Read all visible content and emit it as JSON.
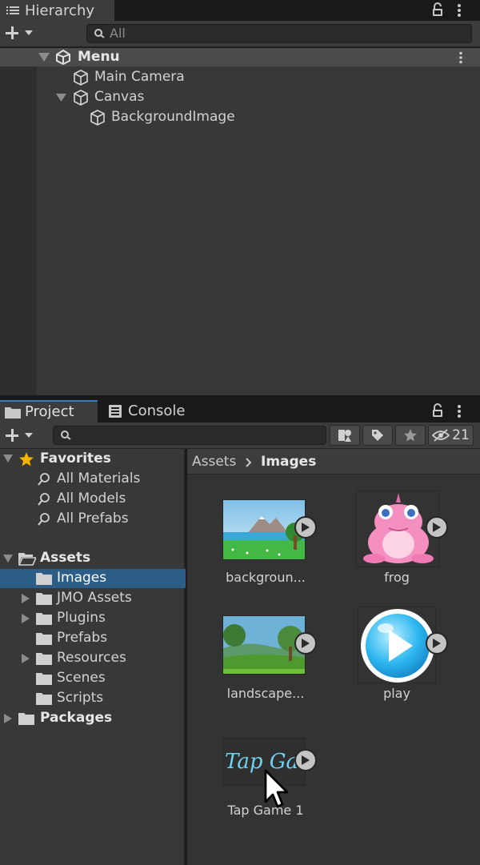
{
  "hierarchy": {
    "tab_label": "Hierarchy",
    "search_placeholder": "All",
    "scene_name": "Menu",
    "items": [
      {
        "label": "Main Camera"
      },
      {
        "label": "Canvas"
      },
      {
        "label": "BackgroundImage"
      }
    ]
  },
  "project": {
    "tabs": [
      {
        "label": "Project"
      },
      {
        "label": "Console"
      }
    ],
    "hidden_count": "21",
    "tree": {
      "favorites_label": "Favorites",
      "favorites": [
        {
          "label": "All Materials"
        },
        {
          "label": "All Models"
        },
        {
          "label": "All Prefabs"
        }
      ],
      "assets_label": "Assets",
      "folders": [
        {
          "label": "Images",
          "selected": true
        },
        {
          "label": "JMO Assets",
          "expandable": true
        },
        {
          "label": "Plugins",
          "expandable": true
        },
        {
          "label": "Prefabs"
        },
        {
          "label": "Resources",
          "expandable": true
        },
        {
          "label": "Scenes"
        },
        {
          "label": "Scripts"
        }
      ],
      "packages_label": "Packages"
    },
    "breadcrumb": {
      "root": "Assets",
      "current": "Images"
    },
    "assets": [
      {
        "label": "backgroun..."
      },
      {
        "label": "frog"
      },
      {
        "label": "landscape..."
      },
      {
        "label": "play"
      },
      {
        "label": "Tap Game 1",
        "thumb_text": "Tap Gam"
      }
    ]
  },
  "colors": {
    "selection": "#2c5d87",
    "accent": "#3a79bb",
    "star": "#f4b400"
  },
  "icons": [
    "hamburger-icon",
    "lock-icon",
    "kebab-icon",
    "plus-icon",
    "search-icon",
    "unity-scene-icon",
    "gameobject-cube-icon",
    "folder-icon",
    "star-icon",
    "tag-icon",
    "eye-slash-icon",
    "play-icon",
    "mouse-cursor-icon"
  ]
}
